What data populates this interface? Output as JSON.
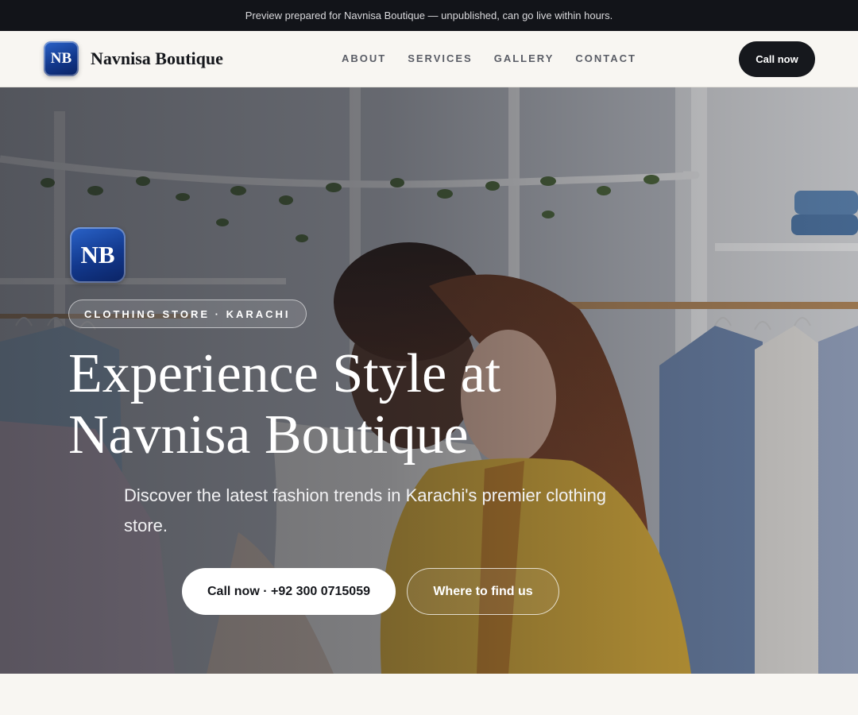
{
  "banner": {
    "text": "Preview prepared for Navnisa Boutique — unpublished, can go live within hours."
  },
  "brand": {
    "initials": "NB",
    "name": "Navnisa Boutique"
  },
  "nav": {
    "links": [
      "ABOUT",
      "SERVICES",
      "GALLERY",
      "CONTACT"
    ],
    "cta_label": "Call now"
  },
  "hero": {
    "initials": "NB",
    "eyebrow": "CLOTHING STORE · KARACHI",
    "headline_line1": "Experience Style at",
    "headline_line2": "Navnisa Boutique",
    "subhead": "Discover the latest fashion trends in Karachi's premier clothing store.",
    "primary_cta": "Call now · +92 300 0715059",
    "secondary_cta": "Where to find us",
    "background_image": "clothing-store-shoppers-photo"
  },
  "colors": {
    "banner_bg": "#121419",
    "page_bg": "#f8f6f2",
    "nav_cta_bg": "#16181d",
    "logo_blue": "#12388c",
    "jacket_yellow": "#e3b43a"
  }
}
